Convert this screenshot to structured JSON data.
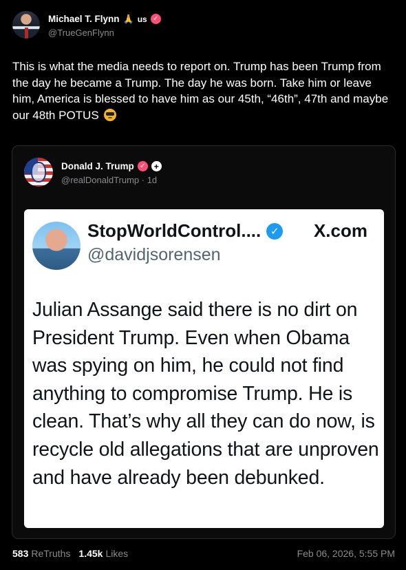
{
  "author": {
    "name": "Michael T. Flynn",
    "flag_label": "us",
    "handle": "@TrueGenFlynn"
  },
  "post": {
    "text": "This is what the media needs to report on. Trump has been Trump from the day he became a Trump. The day he was born. Take him or leave him, America is blessed to have him as our 45th, “46th”, 47th and maybe our 48th POTUS",
    "emoji": "smiling-face-with-sunglasses"
  },
  "quote": {
    "name": "Donald J. Trump",
    "handle_and_time": "@realDonaldTrump · 1d",
    "image": {
      "name": "StopWorldControl....",
      "handle": "@davidjsorensen",
      "site": "X.com",
      "body": "Julian Assange said there is no dirt on President Trump. Even when Obama was spying on him, he could not find anything to compromise Trump. He is clean. That’s why all they can do now, is recycle old allegations that are unproven and have already been debunked."
    }
  },
  "footer": {
    "retruths_count": "583",
    "retruths_label": "ReTruths",
    "likes_count": "1.45k",
    "likes_label": "Likes",
    "timestamp": "Feb 06, 2026, 5:55 PM"
  },
  "colors": {
    "background": "#000000",
    "verified_badge": "#ff4f74",
    "muted_text": "#8b8b8e",
    "x_verified": "#1d9bf0"
  }
}
